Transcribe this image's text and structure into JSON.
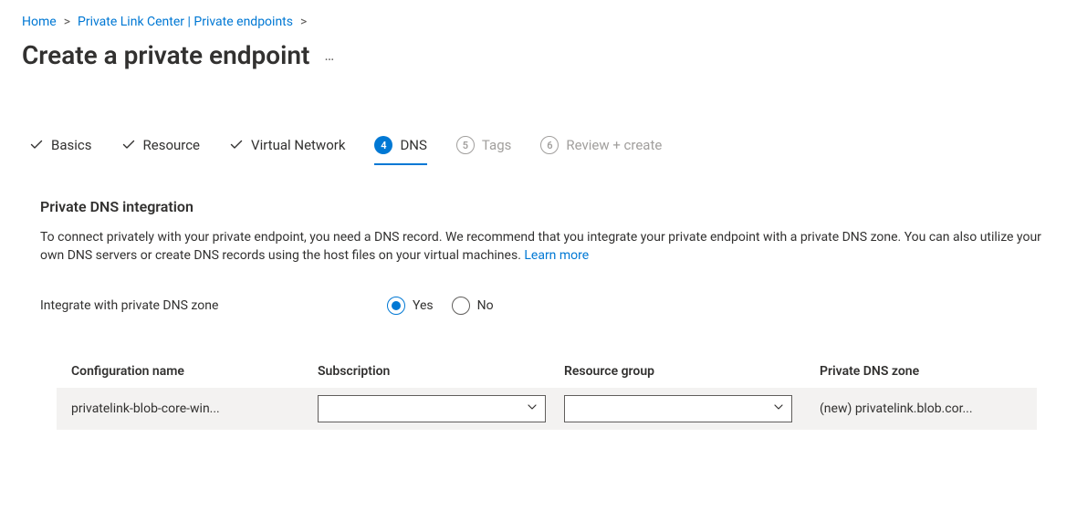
{
  "breadcrumb": {
    "home": "Home",
    "plc": "Private Link Center | Private endpoints"
  },
  "page": {
    "title": "Create a private endpoint"
  },
  "tabs": {
    "basics": "Basics",
    "resource": "Resource",
    "vnet": "Virtual Network",
    "dns_num": "4",
    "dns": "DNS",
    "tags_num": "5",
    "tags": "Tags",
    "review_num": "6",
    "review": "Review + create"
  },
  "section": {
    "heading": "Private DNS integration",
    "desc_prefix": "To connect privately with your private endpoint, you need a DNS record. We recommend that you integrate your private endpoint with a private DNS zone. You can also utilize your own DNS servers or create DNS records using the host files on your virtual machines. ",
    "learn_more": "Learn more"
  },
  "form": {
    "integrate_label": "Integrate with private DNS zone",
    "yes": "Yes",
    "no": "No"
  },
  "table": {
    "headers": {
      "config": "Configuration name",
      "subscription": "Subscription",
      "rg": "Resource group",
      "zone": "Private DNS zone"
    },
    "row": {
      "config": "privatelink-blob-core-win...",
      "subscription": "",
      "rg": "",
      "zone": "(new) privatelink.blob.cor..."
    }
  }
}
